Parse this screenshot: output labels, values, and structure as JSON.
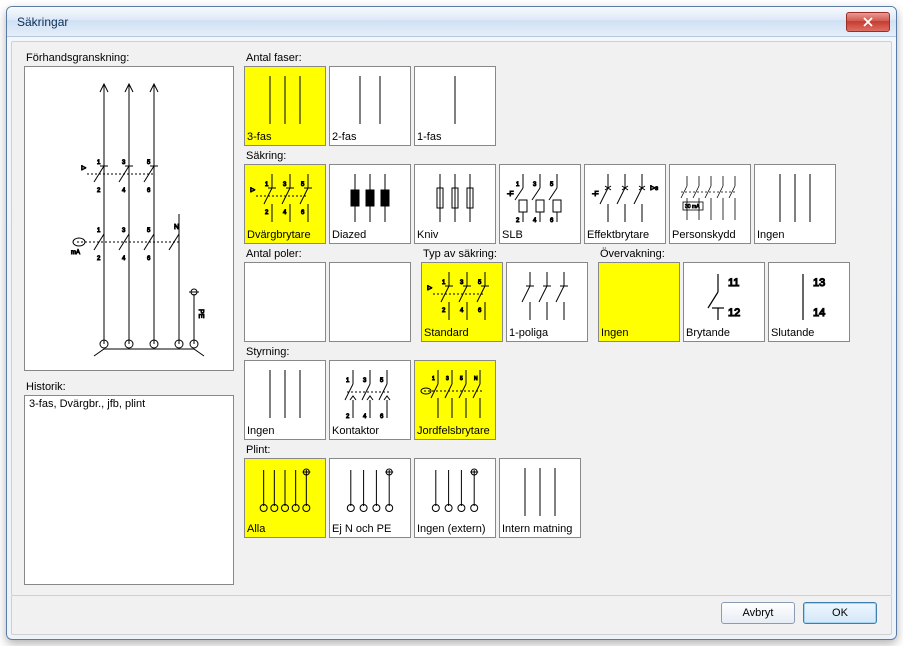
{
  "window": {
    "title": "Säkringar"
  },
  "labels": {
    "preview": "Förhandsgranskning:",
    "history": "Historik:",
    "phases": "Antal faser:",
    "fuse": "Säkring:",
    "poles": "Antal poler:",
    "fusetype": "Typ av säkring:",
    "monitor": "Övervakning:",
    "control": "Styrning:",
    "terminal": "Plint:"
  },
  "history_text": "3-fas, Dvärgbr., jfb, plint",
  "phases": {
    "items": [
      {
        "label": "3-fas",
        "selected": true
      },
      {
        "label": "2-fas",
        "selected": false
      },
      {
        "label": "1-fas",
        "selected": false
      }
    ]
  },
  "fuse": {
    "items": [
      {
        "label": "Dvärgbrytare",
        "selected": true
      },
      {
        "label": "Diazed",
        "selected": false
      },
      {
        "label": "Kniv",
        "selected": false
      },
      {
        "label": "SLB",
        "selected": false
      },
      {
        "label": "Effektbrytare",
        "selected": false
      },
      {
        "label": "Personskydd",
        "selected": false
      },
      {
        "label": "Ingen",
        "selected": false
      }
    ]
  },
  "poles": {
    "items": [
      {
        "label": "",
        "selected": false
      },
      {
        "label": "",
        "selected": false
      }
    ]
  },
  "fusetype": {
    "items": [
      {
        "label": "Standard",
        "selected": true
      },
      {
        "label": "1-poliga",
        "selected": false
      }
    ]
  },
  "monitor": {
    "items": [
      {
        "label": "Ingen",
        "selected": true
      },
      {
        "label": "Brytande",
        "selected": false
      },
      {
        "label": "Slutande",
        "selected": false
      }
    ]
  },
  "control": {
    "items": [
      {
        "label": "Ingen",
        "selected": false
      },
      {
        "label": "Kontaktor",
        "selected": false
      },
      {
        "label": "Jordfelsbrytare",
        "selected": true
      }
    ]
  },
  "terminal": {
    "items": [
      {
        "label": "Alla",
        "selected": true
      },
      {
        "label": "Ej N och PE",
        "selected": false
      },
      {
        "label": "Ingen (extern)",
        "selected": false
      },
      {
        "label": "Intern matning",
        "selected": false
      }
    ]
  },
  "buttons": {
    "cancel": "Avbryt",
    "ok": "OK"
  },
  "monitor_nums": {
    "b1": "11",
    "b2": "12",
    "s1": "13",
    "s2": "14"
  }
}
